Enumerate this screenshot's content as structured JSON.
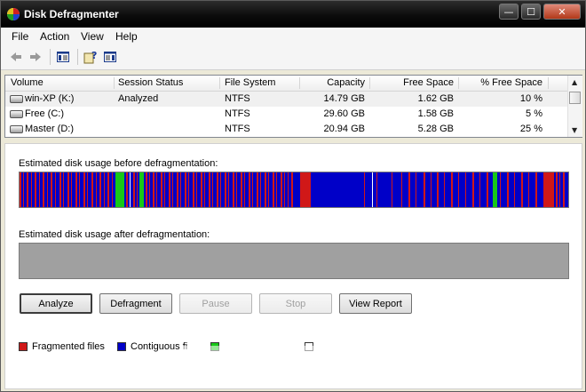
{
  "window": {
    "title": "Disk Defragmenter",
    "min_glyph": "—",
    "max_glyph": "☐",
    "close_glyph": "✕"
  },
  "menu": [
    "File",
    "Action",
    "View",
    "Help"
  ],
  "toolbar": {
    "icons": [
      "back-arrow-icon",
      "forward-arrow-icon",
      "properties-icon",
      "help-icon",
      "console-tree-icon"
    ]
  },
  "columns": [
    "Volume",
    "Session Status",
    "File System",
    "Capacity",
    "Free Space",
    "% Free Space"
  ],
  "volumes": [
    {
      "name": "win-XP (K:)",
      "status": "Analyzed",
      "fs": "NTFS",
      "capacity": "14.79 GB",
      "free": "1.62 GB",
      "pct": "10 %"
    },
    {
      "name": "Free (C:)",
      "status": "",
      "fs": "NTFS",
      "capacity": "29.60 GB",
      "free": "1.58 GB",
      "pct": "5 %"
    },
    {
      "name": "Master (D:)",
      "status": "",
      "fs": "NTFS",
      "capacity": "20.94 GB",
      "free": "5.28 GB",
      "pct": "25 %"
    }
  ],
  "before_label": "Estimated disk usage before defragmentation:",
  "after_label": "Estimated disk usage after defragmentation:",
  "buttons": {
    "analyze": "Analyze",
    "defragment": "Defragment",
    "pause": "Pause",
    "stop": "Stop",
    "view_report": "View Report"
  },
  "legend": [
    {
      "label": "Fragmented files",
      "color": "#d01818"
    },
    {
      "label": "Contiguous fi",
      "color": "#0000c8"
    },
    {
      "label": "",
      "color": "#18c818"
    },
    {
      "label": "",
      "color": "#ffffff"
    }
  ],
  "colors": {
    "fragmented": "#d01818",
    "contiguous": "#0000c8",
    "unmovable": "#18c818",
    "free": "#ffffff"
  }
}
